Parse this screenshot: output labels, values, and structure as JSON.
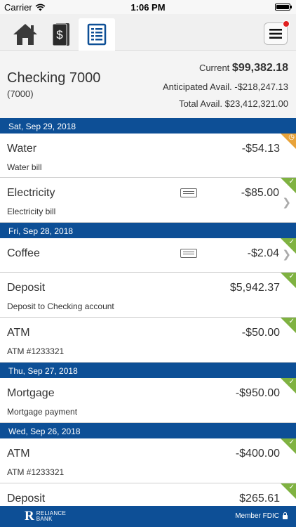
{
  "status_bar": {
    "carrier": "Carrier",
    "time": "1:06 PM"
  },
  "tabs": [
    {
      "name": "home-icon"
    },
    {
      "name": "money-icon"
    },
    {
      "name": "statement-icon",
      "active": true
    }
  ],
  "account": {
    "name": "Checking 7000",
    "number": "(7000)",
    "current_label": "Current",
    "current_value": "$99,382.18",
    "anticipated_label": "Anticipated Avail.",
    "anticipated_value": "-$218,247.13",
    "total_label": "Total Avail.",
    "total_value": "$23,412,321.00"
  },
  "groups": [
    {
      "date": "Sat, Sep 29, 2018",
      "transactions": [
        {
          "title": "Water",
          "description": "Water bill",
          "amount": "-$54.13",
          "status": "pending"
        },
        {
          "title": "Electricity",
          "description": "Electricity bill",
          "amount": "-$85.00",
          "status": "cleared"
        }
      ]
    },
    {
      "date": "Fri, Sep 28, 2018",
      "transactions": [
        {
          "title": "Coffee",
          "description": "",
          "amount": "-$2.04",
          "status": "cleared"
        },
        {
          "title": "Deposit",
          "description": "Deposit to Checking account",
          "amount": "$5,942.37",
          "status": "cleared"
        },
        {
          "title": "ATM",
          "description": "ATM #1233321",
          "amount": "-$50.00",
          "status": "cleared"
        }
      ]
    },
    {
      "date": "Thu, Sep 27, 2018",
      "transactions": [
        {
          "title": "Mortgage",
          "description": "Mortgage payment",
          "amount": "-$950.00",
          "status": "cleared"
        }
      ]
    },
    {
      "date": "Wed, Sep 26, 2018",
      "transactions": [
        {
          "title": "ATM",
          "description": "ATM #1233321",
          "amount": "-$400.00",
          "status": "cleared"
        },
        {
          "title": "Deposit",
          "description": "",
          "amount": "$265.61",
          "status": "cleared"
        }
      ]
    }
  ],
  "footer": {
    "logo_line1": "RELIANCE",
    "logo_line2": "BANK",
    "member": "Member FDIC"
  },
  "colors": {
    "brand_blue": "#0d4f96",
    "cleared_green": "#7fb241",
    "pending_orange": "#e8a33a"
  }
}
